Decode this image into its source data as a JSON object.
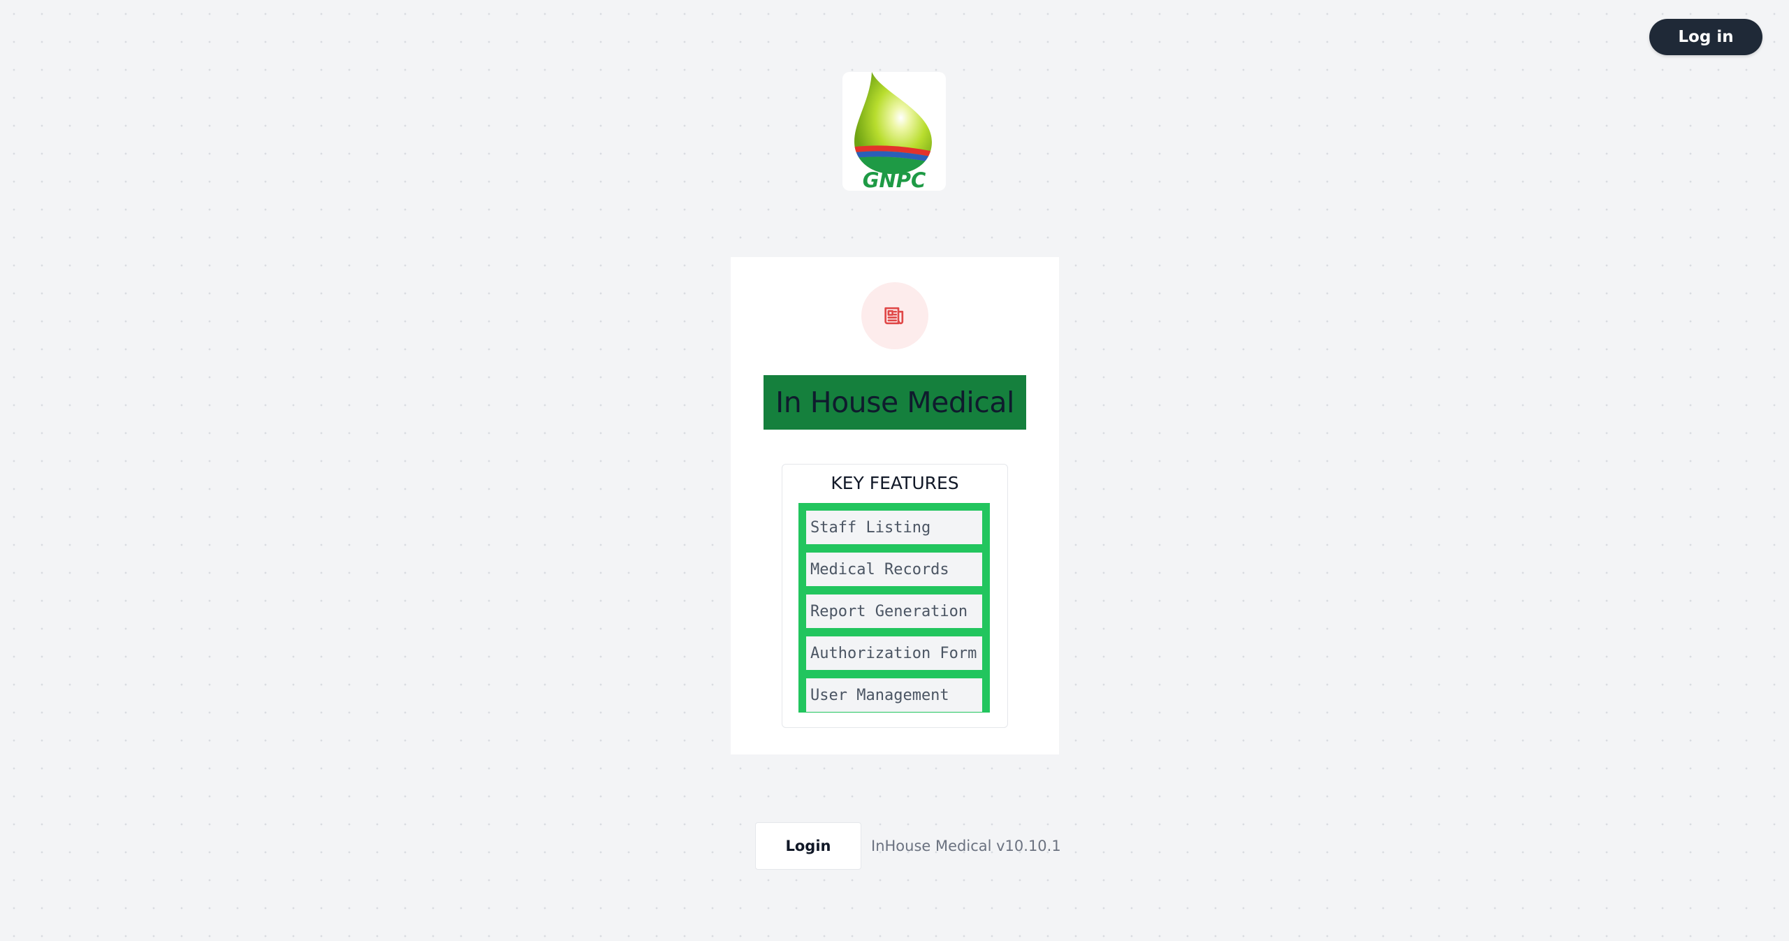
{
  "header": {
    "login_label": "Log in"
  },
  "logo": {
    "icon": "gnpc-drop-logo",
    "wordmark": "GNPC",
    "colors": {
      "drop_light": "#d9ef6a",
      "drop_dark": "#7cb518",
      "wordmark": "#1e9a45",
      "stripe_red": "#e3322b",
      "stripe_blue": "#2b5fb8",
      "stripe_green": "#1e9a45"
    }
  },
  "card": {
    "icon": "newspaper-icon",
    "title": "In House Medical",
    "features_heading": "KEY FEATURES",
    "features": [
      {
        "label": "Staff Listing"
      },
      {
        "label": "Medical Records"
      },
      {
        "label": "Report Generation"
      },
      {
        "label": "Authorization Form"
      },
      {
        "label": "User Management"
      }
    ]
  },
  "footer": {
    "login_label": "Login",
    "version_text": "InHouse Medical v10.10.1"
  },
  "colors": {
    "header_button_bg": "#1f2937",
    "title_banner_bg": "#15803d",
    "features_list_bg": "#22c55e",
    "icon_circle_bg": "#fdecec",
    "icon_color": "#e04848"
  }
}
